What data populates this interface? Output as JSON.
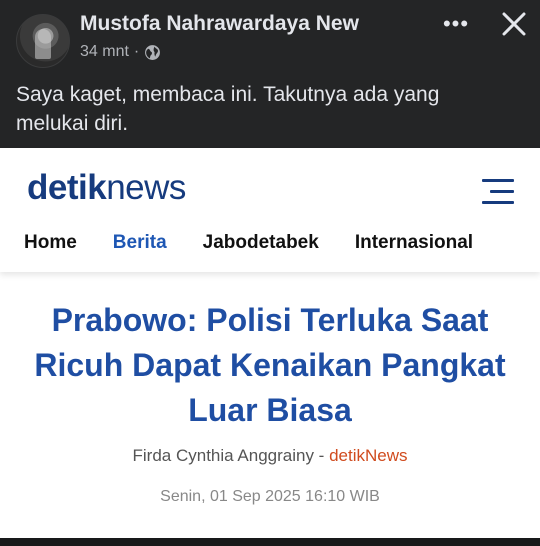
{
  "post": {
    "author": "Mustofa Nahrawardaya New",
    "time": "34 mnt",
    "separator": "·",
    "privacy_icon": "globe-icon",
    "more_icon": "more-icon",
    "close_icon": "close-icon",
    "caption": "Saya kaget, membaca ini. Takutnya ada yang melukai diri."
  },
  "article": {
    "logo_detik": "detik",
    "logo_news": "news",
    "menu_icon": "hamburger-icon",
    "tabs": [
      {
        "label": "Home"
      },
      {
        "label": "Berita"
      },
      {
        "label": "Jabodetabek"
      },
      {
        "label": "Internasional"
      }
    ],
    "headline": "Prabowo: Polisi Terluka Saat Ricuh Dapat Kenaikan Pangkat Luar Biasa",
    "author": "Firda Cynthia Anggrainy",
    "byline_sep": " - ",
    "source": "detikNews",
    "date": "Senin, 01 Sep 2025 16:10 WIB"
  },
  "colors": {
    "background": "#242526",
    "brand_blue": "#163b7e",
    "headline_blue": "#1f4ea3",
    "active_tab": "#1e57b4",
    "source_orange": "#d04b1e"
  }
}
